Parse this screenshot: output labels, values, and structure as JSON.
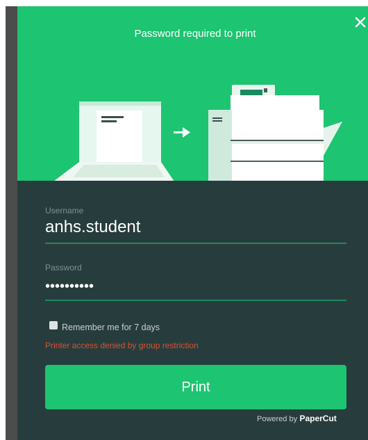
{
  "dialog": {
    "title": "Password required to print",
    "close_icon": "close-icon"
  },
  "form": {
    "username_label": "Username",
    "username_value": "anhs.student",
    "password_label": "Password",
    "password_value": "••••••••••",
    "remember_label": "Remember me for 7 days",
    "remember_checked": false,
    "error_message": "Printer access denied by group restriction",
    "print_button_label": "Print"
  },
  "footer": {
    "powered_by": "Powered by",
    "brand": "PaperCut"
  },
  "colors": {
    "accent": "#1dc471",
    "panel": "#273d3d",
    "error": "#e04f2b"
  }
}
